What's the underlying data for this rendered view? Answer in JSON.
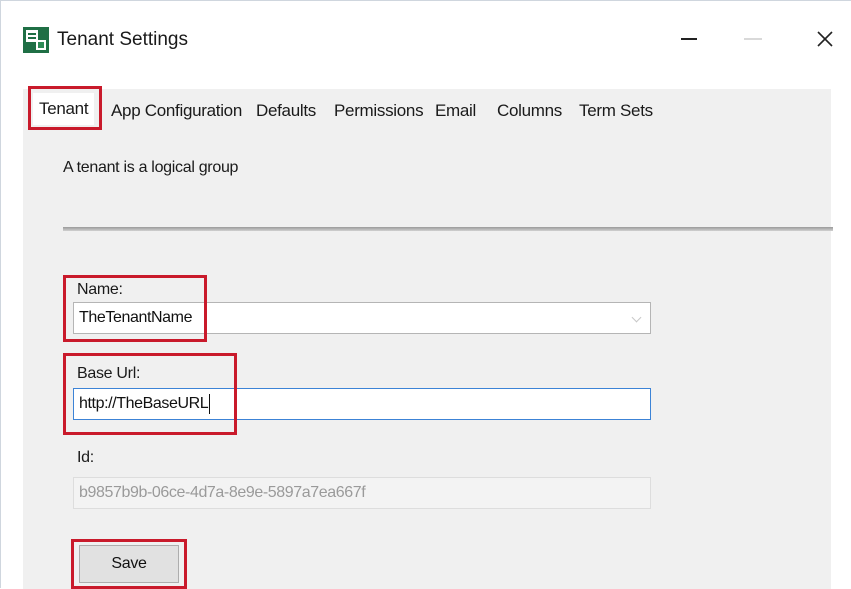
{
  "window": {
    "title": "Tenant Settings",
    "icon": "app-icon",
    "controls": [
      "minimize-icon",
      "maximize-icon",
      "close-icon"
    ],
    "close_glyph": "✕"
  },
  "tabs": [
    {
      "label": "Tenant",
      "active": true
    },
    {
      "label": "App Configuration",
      "active": false
    },
    {
      "label": "Defaults",
      "active": false
    },
    {
      "label": "Permissions",
      "active": false
    },
    {
      "label": "Email",
      "active": false
    },
    {
      "label": "Columns",
      "active": false
    },
    {
      "label": "Term Sets",
      "active": false
    }
  ],
  "panel": {
    "description": "A tenant is a logical group"
  },
  "form": {
    "name_label": "Name:",
    "name_value": "TheTenantName",
    "base_url_label": "Base Url:",
    "base_url_value": "http://TheBaseURL",
    "id_label": "Id:",
    "id_value": "b9857b9b-06ce-4d7a-8e9e-5897a7ea667f",
    "save_label": "Save"
  },
  "colors": {
    "highlight": "#c91a2b",
    "panel_bg": "#f0f0f0",
    "focus_border": "#3c83d6"
  }
}
